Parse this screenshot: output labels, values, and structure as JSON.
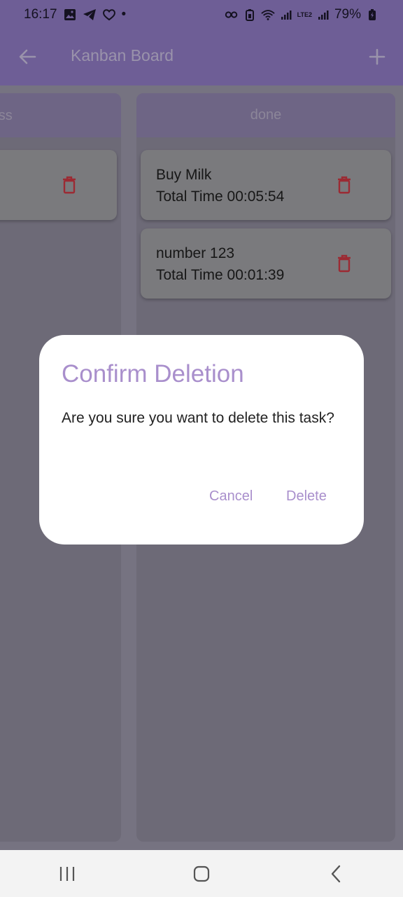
{
  "status_bar": {
    "time": "16:17",
    "dot": "•",
    "lte_label": "LTE2",
    "battery": "79%"
  },
  "app_bar": {
    "title": "Kanban Board",
    "back_icon": "arrow-left-icon",
    "add_icon": "plus-icon"
  },
  "columns": [
    {
      "name": "ress",
      "cards": [
        {
          "title": "",
          "time": ""
        }
      ]
    },
    {
      "name": "done",
      "cards": [
        {
          "title": "Buy Milk",
          "time": "Total Time 00:05:54"
        },
        {
          "title": "number 123",
          "time": "Total Time 00:01:39"
        }
      ]
    }
  ],
  "dialog": {
    "title": "Confirm Deletion",
    "message": "Are you sure you want to delete this task?",
    "cancel_label": "Cancel",
    "delete_label": "Delete"
  },
  "colors": {
    "accent": "#a98fcc",
    "app_bar": "#6e5e96",
    "trash": "#9c2a33"
  }
}
